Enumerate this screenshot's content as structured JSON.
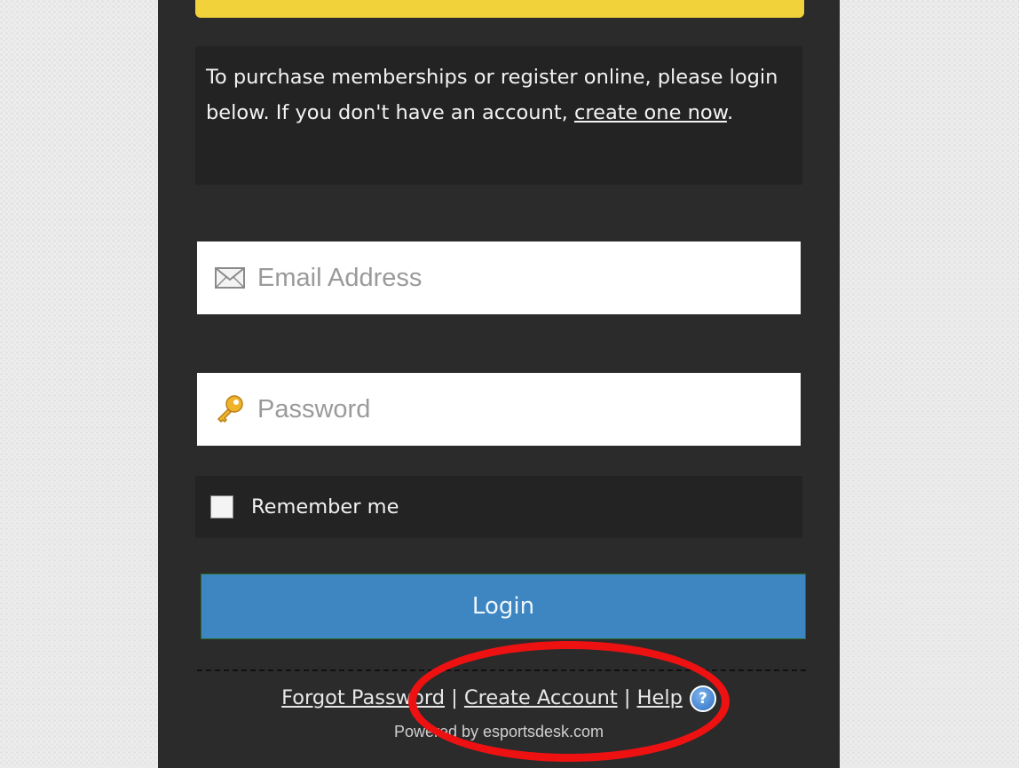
{
  "notice": {
    "text_before": "To purchase memberships or register online, please login below. If you don't have an account, ",
    "link": "create one now",
    "text_after": "."
  },
  "form": {
    "email_placeholder": "Email Address",
    "email_icon": "envelope-icon",
    "password_placeholder": "Password",
    "password_icon": "key-icon",
    "remember_label": "Remember me",
    "login_label": "Login",
    "login_color": "#3d86c2"
  },
  "footer": {
    "forgot_password": "Forgot Password",
    "separator": "|",
    "create_account": "Create Account",
    "help": "Help",
    "help_icon": "help-question-icon",
    "powered_by": "Powered by esportsdesk.com"
  },
  "annotation": {
    "highlight_color": "#ee1111"
  }
}
